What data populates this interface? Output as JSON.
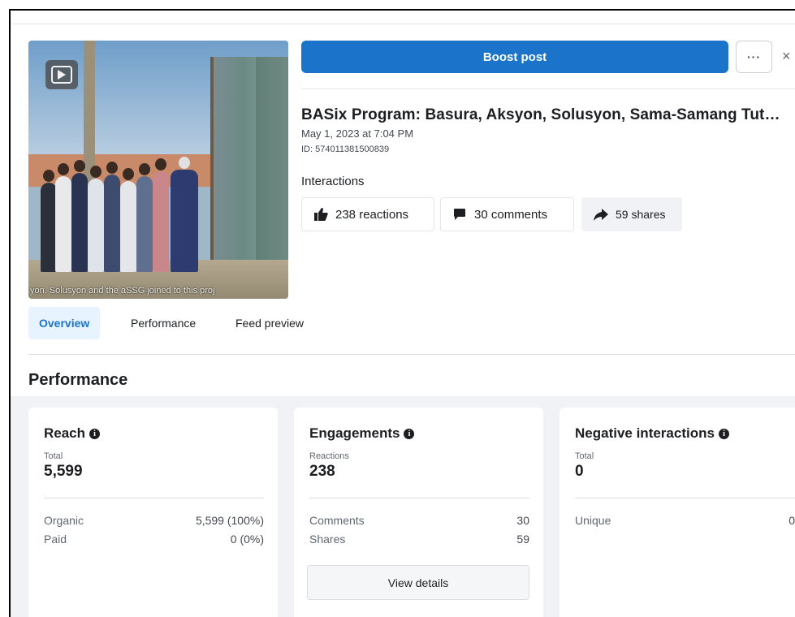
{
  "media": {
    "caption": "yon. Solusyon and the aSSG joined to this proj",
    "play_icon": "video-play-icon"
  },
  "header": {
    "boost_label": "Boost post",
    "more_label": "···",
    "close_label": "×"
  },
  "post": {
    "title": "BASix Program: Basura, Aksyon, Solusyon, Sama-Samang Tut…",
    "date": "May 1, 2023 at 7:04 PM",
    "id": "ID: 574011381500839"
  },
  "interactions": {
    "label": "Interactions",
    "reactions": "238 reactions",
    "comments": "30 comments",
    "shares": "59 shares"
  },
  "tabs": [
    {
      "label": "Overview",
      "active": true
    },
    {
      "label": "Performance",
      "active": false
    },
    {
      "label": "Feed preview",
      "active": false
    }
  ],
  "performance": {
    "title": "Performance",
    "reach": {
      "title": "Reach",
      "sub": "Total",
      "value": "5,599",
      "rows": [
        {
          "label": "Organic",
          "value": "5,599 (100%)"
        },
        {
          "label": "Paid",
          "value": "0 (0%)"
        }
      ]
    },
    "engagements": {
      "title": "Engagements",
      "sub": "Reactions",
      "value": "238",
      "rows": [
        {
          "label": "Comments",
          "value": "30"
        },
        {
          "label": "Shares",
          "value": "59"
        }
      ],
      "button": "View details"
    },
    "negative": {
      "title": "Negative interactions",
      "sub": "Total",
      "value": "0",
      "rows": [
        {
          "label": "Unique",
          "value": "0"
        }
      ]
    }
  },
  "colors": {
    "accent": "#1b74c9",
    "tab_active_bg": "#e7f3ff",
    "panel_bg": "#f0f2f5"
  }
}
